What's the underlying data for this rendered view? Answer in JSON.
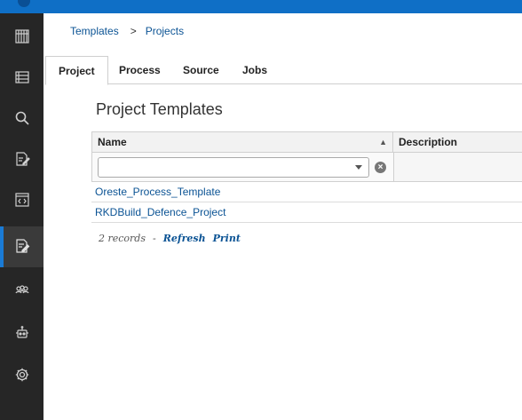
{
  "breadcrumb": {
    "items": [
      {
        "label": "Templates"
      },
      {
        "label": "Projects"
      }
    ],
    "separator": ">"
  },
  "sidebar": {
    "items": [
      {
        "icon": "building-icon",
        "active": false
      },
      {
        "icon": "list-icon",
        "active": false
      },
      {
        "icon": "search-icon",
        "active": false
      },
      {
        "icon": "edit-document-icon",
        "active": false
      },
      {
        "icon": "code-window-icon",
        "active": false
      },
      {
        "icon": "template-edit-icon",
        "active": true
      },
      {
        "icon": "group-icon",
        "active": false
      },
      {
        "icon": "robot-icon",
        "active": false
      },
      {
        "icon": "gear-icon",
        "active": false
      }
    ]
  },
  "tabs": [
    {
      "label": "Project",
      "active": true
    },
    {
      "label": "Process",
      "active": false
    },
    {
      "label": "Source",
      "active": false
    },
    {
      "label": "Jobs",
      "active": false
    }
  ],
  "page": {
    "title": "Project Templates"
  },
  "grid": {
    "columns": [
      {
        "label": "Name",
        "sort": "ascending"
      },
      {
        "label": "Description"
      }
    ],
    "filter_value": "",
    "rows": [
      {
        "name": "Oreste_Process_Template"
      },
      {
        "name": "RKDBuild_Defence_Project"
      }
    ]
  },
  "footer": {
    "records": "2 records",
    "dash": "-",
    "refresh_label": "Refresh",
    "print_label": "Print"
  },
  "colors": {
    "topbar": "#0f6fc6",
    "sidebar": "#262626",
    "link": "#0b5394",
    "active_indicator": "#1a7bd6"
  }
}
